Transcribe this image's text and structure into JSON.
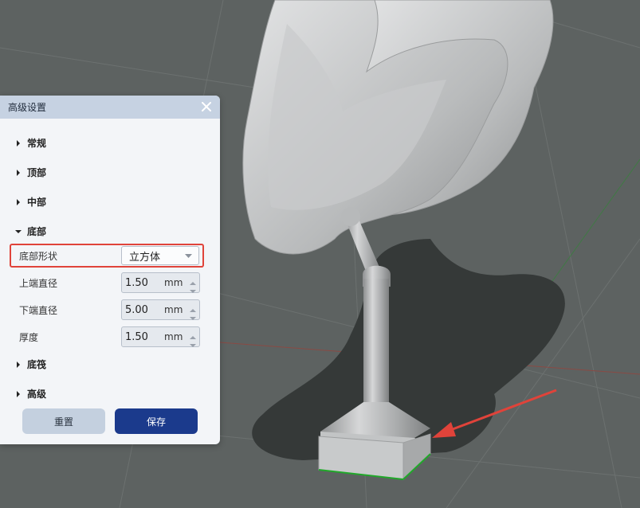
{
  "panel": {
    "title": "高级设置",
    "sections": {
      "general": "常规",
      "top": "顶部",
      "middle": "中部",
      "bottom": "底部",
      "bottom_mesh": "底筏",
      "advanced": "高级"
    },
    "bottom_fields": {
      "shape_label": "底部形状",
      "shape_value": "立方体",
      "upper_diameter_label": "上端直径",
      "upper_diameter_value": "1.50",
      "lower_diameter_label": "下端直径",
      "lower_diameter_value": "5.00",
      "thickness_label": "厚度",
      "thickness_value": "1.50",
      "unit": "mm"
    },
    "buttons": {
      "reset": "重置",
      "save": "保存"
    }
  },
  "colors": {
    "viewport_bg": "#5d6261",
    "panel_bg": "#f3f5f8",
    "header_bg": "#c6d2e2",
    "highlight": "#e0433a",
    "save_button": "#1b3a8c",
    "reset_button": "#c4d0df"
  }
}
